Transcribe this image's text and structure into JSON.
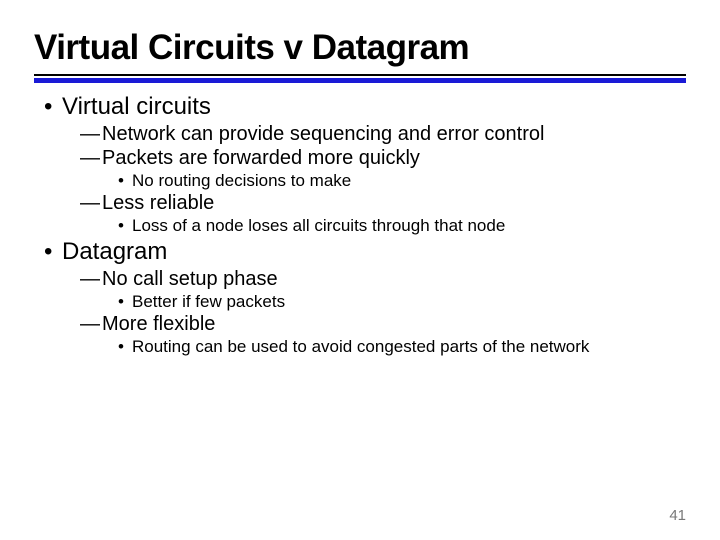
{
  "title": "Virtual Circuits v Datagram",
  "page_number": "41",
  "items": [
    {
      "level": 1,
      "text": "Virtual circuits"
    },
    {
      "level": 2,
      "text": "Network can provide sequencing and error control"
    },
    {
      "level": 2,
      "text": "Packets are forwarded more quickly"
    },
    {
      "level": 3,
      "text": "No routing decisions to make"
    },
    {
      "level": 2,
      "text": "Less reliable"
    },
    {
      "level": 3,
      "text": "Loss of a node loses all circuits through that node"
    },
    {
      "level": 1,
      "text": "Datagram"
    },
    {
      "level": 2,
      "text": "No call setup phase"
    },
    {
      "level": 3,
      "text": "Better if few packets"
    },
    {
      "level": 2,
      "text": "More flexible"
    },
    {
      "level": 3,
      "text": "Routing can be used to avoid congested parts of the network"
    }
  ]
}
